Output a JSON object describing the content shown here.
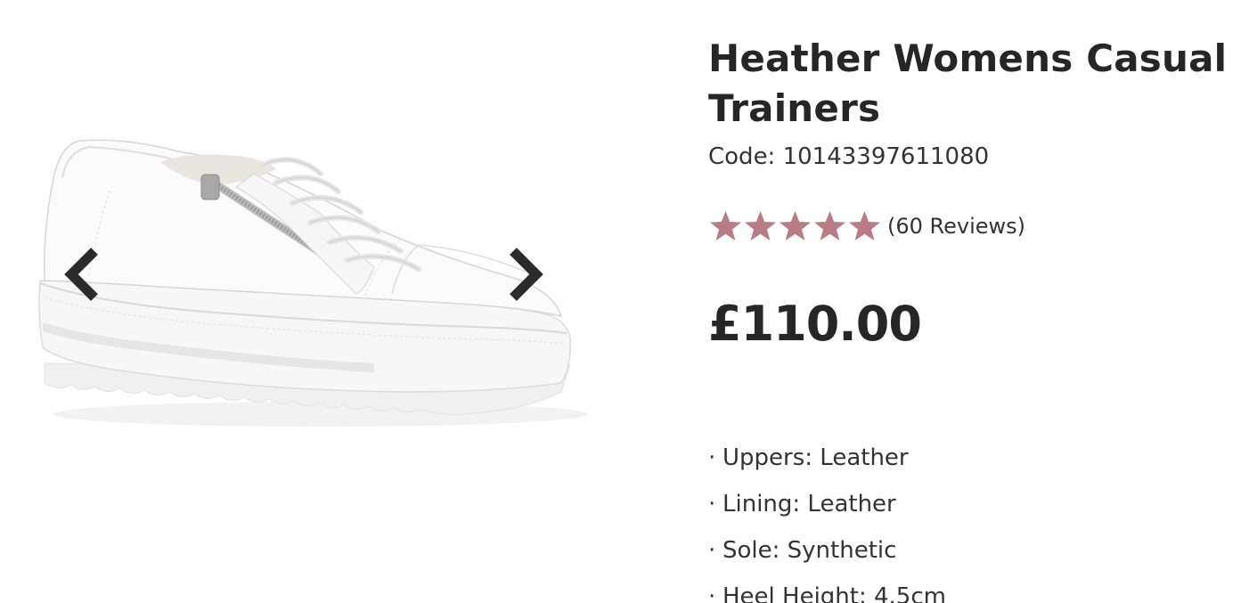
{
  "product": {
    "title": "Heather Womens Casual Trainers",
    "code": "Code: 10143397611080",
    "rating": {
      "stars": 5,
      "max_stars": 5,
      "reviews_label": "(60 Reviews)",
      "star_color": "#b97b86"
    },
    "price": "£110.00",
    "features": [
      "Uppers: Leather",
      "Lining: Leather",
      "Sole: Synthetic",
      "Heel Height: 4.5cm"
    ]
  },
  "gallery": {
    "prev_icon": "chevron-left-icon",
    "next_icon": "chevron-right-icon",
    "image": "white-leather-platform-trainer"
  },
  "colors": {
    "text": "#262626",
    "arrow": "#2b2b2b"
  }
}
